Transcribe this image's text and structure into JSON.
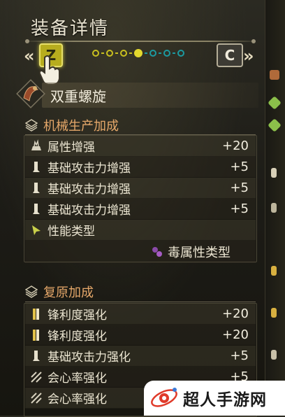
{
  "screen": {
    "title": "装备详情"
  },
  "nav": {
    "left_arrow": "«",
    "right_arrow": "»",
    "left_key": "Z",
    "right_key": "C",
    "page_total": 7,
    "page_active": 4
  },
  "weapon": {
    "name": "双重螺旋"
  },
  "sections": [
    {
      "title": "机械生产加成",
      "rows": [
        {
          "icon": "element-icon",
          "label": "属性增强",
          "value": "+20"
        },
        {
          "icon": "attack-icon",
          "label": "基础攻击力增强",
          "value": "+5"
        },
        {
          "icon": "attack-icon",
          "label": "基础攻击力增强",
          "value": "+5"
        },
        {
          "icon": "attack-icon",
          "label": "基础攻击力增强",
          "value": "+5"
        },
        {
          "icon": "type-cursor-icon",
          "label": "性能类型",
          "value": ""
        }
      ],
      "sub": {
        "label": "毒属性类型"
      }
    },
    {
      "title": "复原加成",
      "rows": [
        {
          "icon": "sharpness-icon",
          "label": "锋利度强化",
          "value": "+20"
        },
        {
          "icon": "sharpness-icon",
          "label": "锋利度强化",
          "value": "+20"
        },
        {
          "icon": "attack-icon",
          "label": "基础攻击力强化",
          "value": "+5"
        },
        {
          "icon": "affinity-icon",
          "label": "会心率强化",
          "value": "+5"
        },
        {
          "icon": "affinity-icon",
          "label": "会心率强化",
          "value": ""
        }
      ]
    }
  ],
  "watermark": {
    "text": "超人手游网"
  },
  "colors": {
    "accent": "#e6a86a",
    "key_active": "#b7ad1e",
    "pager_gold": "#d8cf2a",
    "pager_teal": "#1c9aa0"
  }
}
